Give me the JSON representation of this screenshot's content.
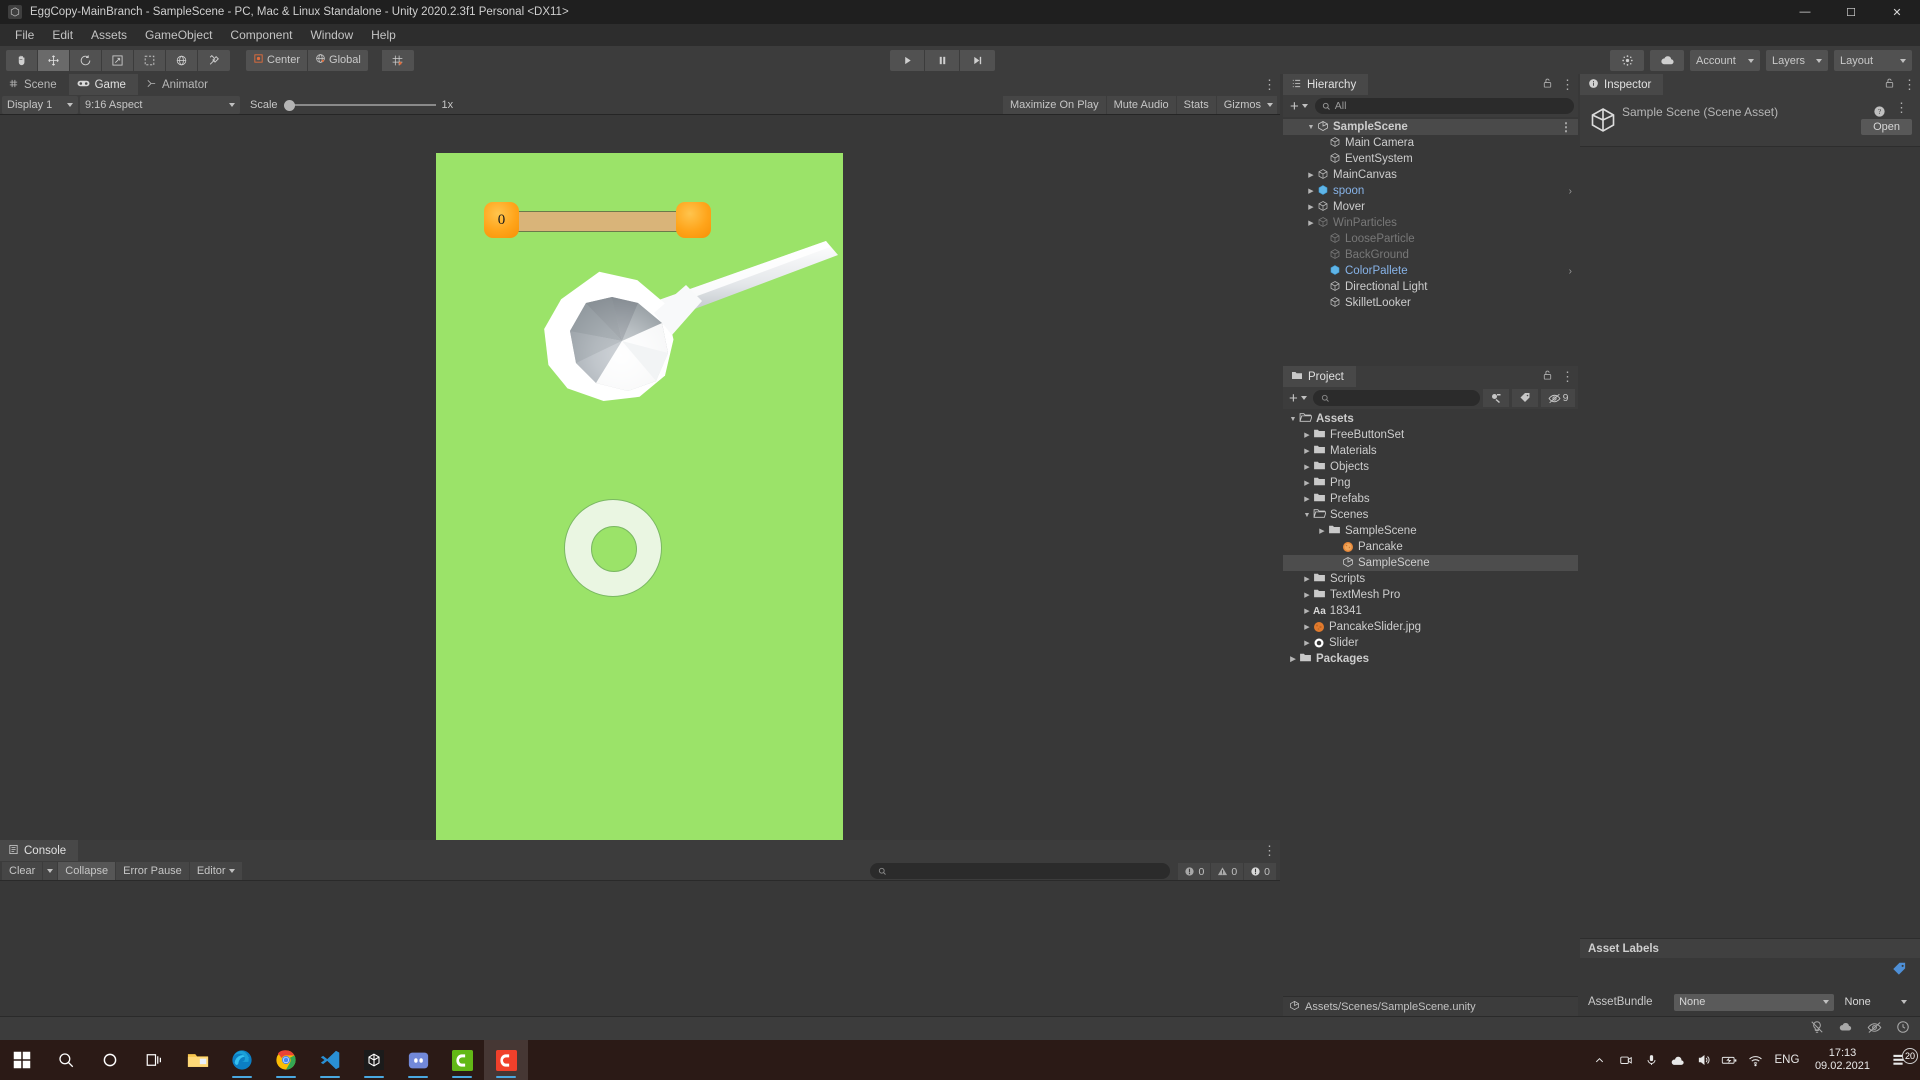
{
  "window": {
    "title": "EggCopy-MainBranch - SampleScene - PC, Mac & Linux Standalone - Unity 2020.2.3f1 Personal <DX11>",
    "app_icon": "unity-icon",
    "minimize": "—",
    "maximize": "☐",
    "close": "✕"
  },
  "menu": {
    "items": [
      {
        "label": "File"
      },
      {
        "label": "Edit"
      },
      {
        "label": "Assets"
      },
      {
        "label": "GameObject"
      },
      {
        "label": "Component"
      },
      {
        "label": "Window"
      },
      {
        "label": "Help"
      }
    ]
  },
  "toolbar": {
    "tools": [
      {
        "name": "hand-tool",
        "glyph": "✋"
      },
      {
        "name": "move-tool",
        "glyph": "✥"
      },
      {
        "name": "rotate-tool",
        "glyph": "↻"
      },
      {
        "name": "scale-tool",
        "glyph": "↗"
      },
      {
        "name": "rect-tool",
        "glyph": "⬚"
      },
      {
        "name": "transform-tool",
        "glyph": "☸"
      },
      {
        "name": "custom-tool",
        "glyph": "⚒"
      }
    ],
    "pivot_mode": "Center",
    "pivot_rotation": "Global",
    "grid_label": "",
    "play": "▶",
    "pause": "‖",
    "step": "⏭",
    "cloud_label": "",
    "account": "Account",
    "layers": "Layers",
    "layout": "Layout"
  },
  "game_panel": {
    "tabs": [
      {
        "label": "Scene",
        "icon": "grid-icon",
        "active": false
      },
      {
        "label": "Game",
        "icon": "gamepad-icon",
        "active": true
      },
      {
        "label": "Animator",
        "icon": "animator-icon",
        "active": false
      }
    ],
    "display": "Display 1",
    "aspect": "9:16 Aspect",
    "scale_label": "Scale",
    "scale_value": "1x",
    "maximize_on_play": "Maximize On Play",
    "mute_audio": "Mute Audio",
    "stats": "Stats",
    "gizmos": "Gizmos"
  },
  "game_view": {
    "background_color": "#9be369",
    "slider_value": "0",
    "slider_fill_color": "#d9b479",
    "knob_color": "#ffa41a",
    "target_ring_color": "#eaf6e2",
    "spoon_color": "#ffffff"
  },
  "console": {
    "tab": "Console",
    "clear": "Clear",
    "collapse": "Collapse",
    "error_pause": "Error Pause",
    "editor": "Editor",
    "search_placeholder": "",
    "counts": {
      "logs": "0",
      "warnings": "0",
      "errors": "0"
    }
  },
  "hierarchy": {
    "tab": "Hierarchy",
    "search_placeholder": "All",
    "create_label": "+",
    "items": [
      {
        "label": "SampleScene",
        "indent": 0,
        "icon": "scene-icon",
        "expanded": true,
        "style": "scene-root",
        "kebab": true
      },
      {
        "label": "Main Camera",
        "indent": 2,
        "icon": "gameobject-icon",
        "style": ""
      },
      {
        "label": "EventSystem",
        "indent": 2,
        "icon": "gameobject-icon",
        "style": ""
      },
      {
        "label": "MainCanvas",
        "indent": 2,
        "icon": "gameobject-icon",
        "arrow": true,
        "style": ""
      },
      {
        "label": "spoon",
        "indent": 2,
        "icon": "prefab-icon",
        "arrow": true,
        "style": "prefab",
        "chevron": true
      },
      {
        "label": "Mover",
        "indent": 2,
        "icon": "gameobject-icon",
        "arrow": true,
        "style": ""
      },
      {
        "label": "WinParticles",
        "indent": 2,
        "icon": "gameobject-icon",
        "arrow": true,
        "style": "dim"
      },
      {
        "label": "LooseParticle",
        "indent": 2,
        "icon": "gameobject-icon",
        "style": "dim"
      },
      {
        "label": "BackGround",
        "indent": 2,
        "icon": "gameobject-icon",
        "style": "dim"
      },
      {
        "label": "ColorPallete",
        "indent": 2,
        "icon": "prefab-icon",
        "style": "prefab",
        "chevron": true
      },
      {
        "label": "Directional Light",
        "indent": 2,
        "icon": "gameobject-icon",
        "style": ""
      },
      {
        "label": "SkilletLooker",
        "indent": 2,
        "icon": "gameobject-icon",
        "style": ""
      }
    ]
  },
  "project": {
    "tab": "Project",
    "search_placeholder": "",
    "create_label": "+",
    "hidden_count": "9",
    "status_path": "Assets/Scenes/SampleScene.unity",
    "items": [
      {
        "label": "Assets",
        "indent": 0,
        "icon": "folder-open-icon",
        "expanded": true,
        "bold": true
      },
      {
        "label": "FreeButtonSet",
        "indent": 1,
        "icon": "folder-icon",
        "arrow": true
      },
      {
        "label": "Materials",
        "indent": 1,
        "icon": "folder-icon",
        "arrow": true
      },
      {
        "label": "Objects",
        "indent": 1,
        "icon": "folder-icon",
        "arrow": true
      },
      {
        "label": "Png",
        "indent": 1,
        "icon": "folder-icon",
        "arrow": true
      },
      {
        "label": "Prefabs",
        "indent": 1,
        "icon": "folder-icon",
        "arrow": true
      },
      {
        "label": "Scenes",
        "indent": 1,
        "icon": "folder-open-icon",
        "expanded": true
      },
      {
        "label": "SampleScene",
        "indent": 2,
        "icon": "folder-icon",
        "arrow": true
      },
      {
        "label": "Pancake",
        "indent": 2,
        "icon": "texture-icon"
      },
      {
        "label": "SampleScene",
        "indent": 2,
        "icon": "scene-icon",
        "selected": true
      },
      {
        "label": "Scripts",
        "indent": 1,
        "icon": "folder-icon",
        "arrow": true
      },
      {
        "label": "TextMesh Pro",
        "indent": 1,
        "icon": "folder-icon",
        "arrow": true
      },
      {
        "label": "18341",
        "indent": 1,
        "icon": "font-icon",
        "arrow": true
      },
      {
        "label": "PancakeSlider.jpg",
        "indent": 1,
        "icon": "texture-icon",
        "arrow": true
      },
      {
        "label": "Slider",
        "indent": 1,
        "icon": "sprite-icon",
        "arrow": true
      },
      {
        "label": "Packages",
        "indent": 0,
        "icon": "folder-icon",
        "arrow": true,
        "bold": true
      }
    ]
  },
  "inspector": {
    "tab": "Inspector",
    "asset_title": "Sample Scene (Scene Asset)",
    "open_button": "Open",
    "asset_labels_header": "Asset Labels",
    "assetbundle_label": "AssetBundle",
    "assetbundle_value": "None",
    "assetbundle_variant": "None"
  },
  "taskbar": {
    "items": [
      {
        "name": "start-button",
        "icon": "windows-icon"
      },
      {
        "name": "search-button",
        "icon": "search-icon"
      },
      {
        "name": "cortana-button",
        "icon": "cortana-icon"
      },
      {
        "name": "task-view-button",
        "icon": "task-view-icon"
      },
      {
        "name": "file-explorer",
        "icon": "folder-icon"
      },
      {
        "name": "edge-browser",
        "icon": "edge-icon"
      },
      {
        "name": "chrome-browser",
        "icon": "chrome-icon"
      },
      {
        "name": "vscode",
        "icon": "vscode-icon"
      },
      {
        "name": "unity-hub",
        "icon": "unity-icon"
      },
      {
        "name": "discord",
        "icon": "discord-icon"
      },
      {
        "name": "unity-editor-green",
        "icon": "unity-green-icon"
      },
      {
        "name": "unity-editor-red",
        "icon": "unity-red-icon"
      }
    ],
    "tray": {
      "language": "ENG",
      "time": "17:13",
      "date": "09.02.2021",
      "notification_count": "20"
    }
  }
}
